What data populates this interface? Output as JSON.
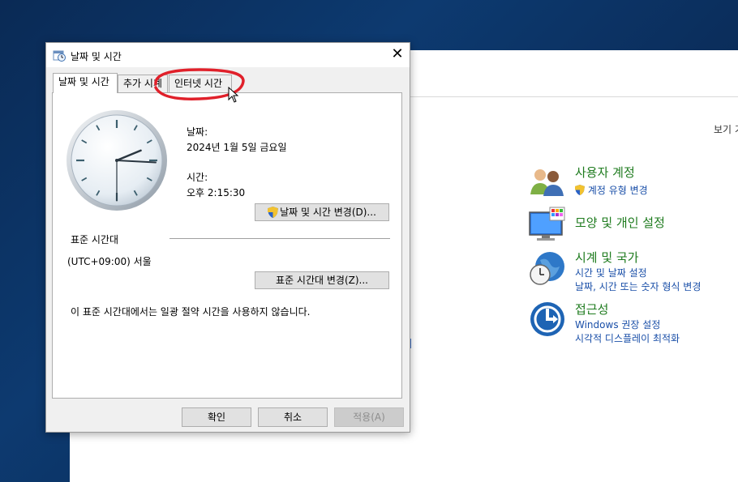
{
  "control_panel": {
    "view_label": "보기 기",
    "categories": [
      {
        "title": "사용자 계정",
        "links": [
          "계정 유형 변경"
        ],
        "icon": "users-icon"
      },
      {
        "title": "모양 및 개인 설정",
        "links": [],
        "icon": "monitor-palette-icon"
      },
      {
        "title": "시계 및 국가",
        "links": [
          "시간 및 날짜 설정",
          "날짜, 시간 또는 숫자 형식 변경"
        ],
        "icon": "globe-clock-icon"
      },
      {
        "title": "접근성",
        "links": [
          "Windows 권장 설정",
          "시각적 디스플레이 최적화"
        ],
        "icon": "accessibility-icon"
      }
    ],
    "title_color": "#1e7b1e",
    "link_color": "#1a4fa8"
  },
  "dialog": {
    "title": "날짜 및 시간",
    "tabs": [
      "날짜 및 시간",
      "추가 시계",
      "인터넷 시간"
    ],
    "date_label": "날짜:",
    "date_value": "2024년 1월 5일 금요일",
    "time_label": "시간:",
    "time_value": "오후 2:15:30",
    "change_datetime_button": "날짜 및 시간 변경(D)...",
    "timezone_section_title": "표준 시간대",
    "timezone_value": "(UTC+09:00) 서울",
    "change_timezone_button": "표준 시간대 변경(Z)...",
    "dst_note": "이 표준 시간대에서는 일광 절약 시간을 사용하지 않습니다.",
    "ok_button": "확인",
    "cancel_button": "취소",
    "apply_button": "적용(A)"
  },
  "clock": {
    "hour": 2,
    "minute": 15,
    "second": 30
  },
  "annotation_color": "#e0202a"
}
